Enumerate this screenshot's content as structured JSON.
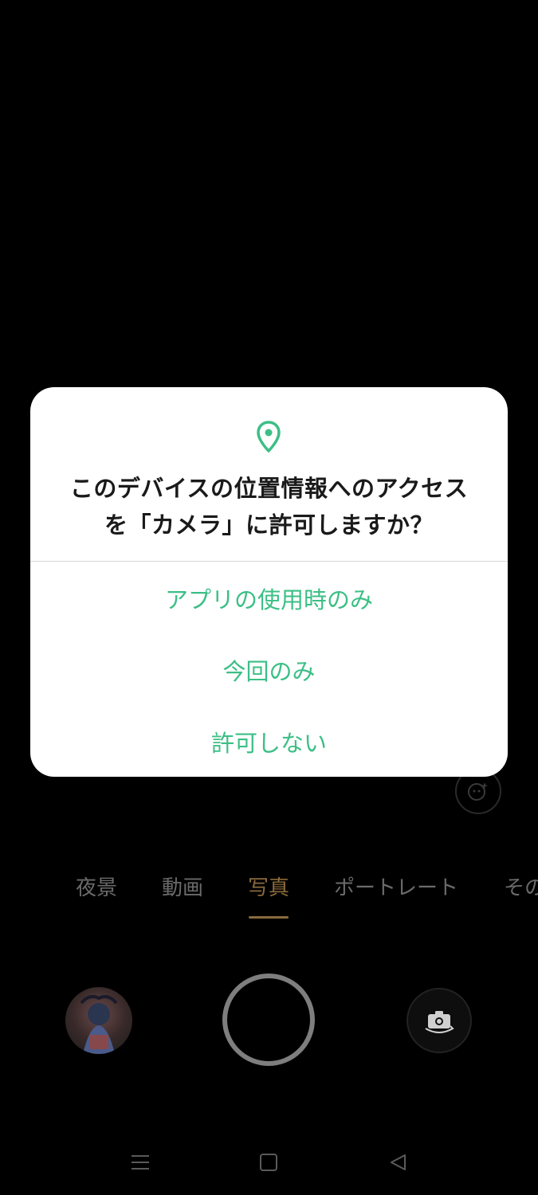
{
  "camera": {
    "modes": [
      "夜景",
      "動画",
      "写真",
      "ポートレート",
      "その"
    ],
    "active_mode": "写真",
    "accent_color": "#8a6a3c"
  },
  "dialog": {
    "icon": "location-pin-icon",
    "title": "このデバイスの位置情報へのアクセスを「カメラ」に許可しますか？",
    "options": [
      "アプリの使用時のみ",
      "今回のみ",
      "許可しない"
    ],
    "accent_color": "#3cbf86"
  },
  "navbar": {
    "icons": [
      "menu-icon",
      "home-icon",
      "back-icon"
    ]
  }
}
